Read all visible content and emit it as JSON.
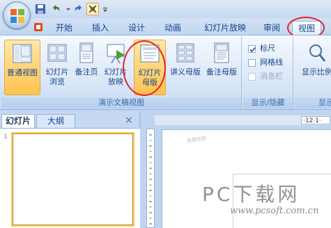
{
  "tabs": [
    "开始",
    "插入",
    "设计",
    "动画",
    "幻灯片放映",
    "审阅",
    "视图"
  ],
  "active_tab": "视图",
  "ribbon": {
    "presentation_views": {
      "label": "演示文稿视图",
      "buttons": [
        {
          "line1": "普通视图",
          "line2": ""
        },
        {
          "line1": "幻灯片",
          "line2": "浏览"
        },
        {
          "line1": "备注页",
          "line2": ""
        },
        {
          "line1": "幻灯片",
          "line2": "放映"
        },
        {
          "line1": "幻灯片",
          "line2": "母版"
        },
        {
          "line1": "讲义母版",
          "line2": ""
        },
        {
          "line1": "备注母版",
          "line2": ""
        }
      ]
    },
    "show_hide": {
      "label": "显示/隐藏",
      "items": [
        {
          "label": "标尺",
          "checked": true,
          "enabled": true
        },
        {
          "label": "网格线",
          "checked": false,
          "enabled": true
        },
        {
          "label": "消息栏",
          "checked": false,
          "enabled": false
        }
      ]
    },
    "zoom": {
      "label": "显示",
      "button": "显示比例"
    }
  },
  "slides_pane": {
    "tabs": [
      "幻灯片",
      "大纲"
    ],
    "active": "幻灯片",
    "close": "×",
    "thumb_number": "1"
  },
  "ruler_number": "·12·1·",
  "watermark": {
    "main": "PC下载网",
    "url": "www.pcsoft.com.cn",
    "small": "百度经验"
  },
  "colors": {
    "highlight_oval": "#e0262b",
    "selected_button": "#ffc24f",
    "accent": "#15428b"
  }
}
